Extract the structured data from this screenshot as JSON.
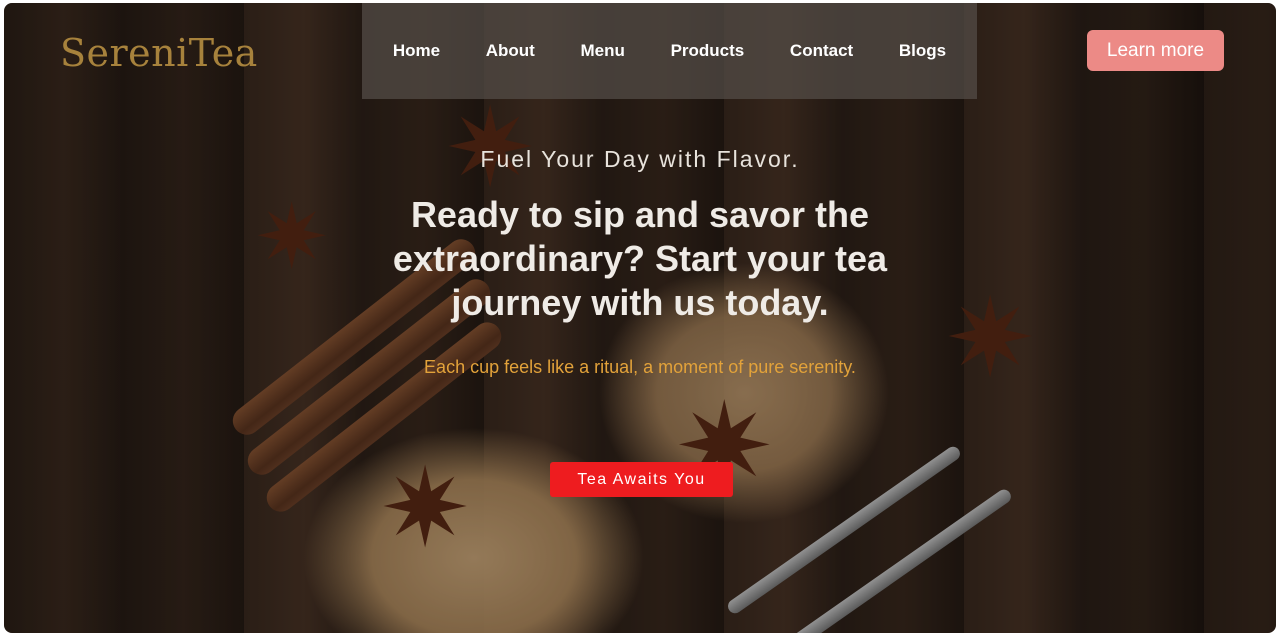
{
  "brand": {
    "name": "SereniTea"
  },
  "nav": {
    "items": [
      {
        "label": "Home"
      },
      {
        "label": "About"
      },
      {
        "label": "Menu"
      },
      {
        "label": "Products"
      },
      {
        "label": "Contact"
      },
      {
        "label": "Blogs"
      }
    ]
  },
  "header": {
    "cta_label": "Learn more"
  },
  "hero": {
    "tagline": "Fuel Your Day with Flavor.",
    "headline": "Ready to sip and savor the extraordinary? Start your tea journey with us today.",
    "subtext": "Each cup feels like a ritual, a moment of pure serenity.",
    "cta_label": "Tea Awaits You"
  },
  "colors": {
    "brand": "#a7823c",
    "learn_more_button": "#ec8a86",
    "cta_button": "#ee1c1f",
    "subtext": "#e2a23a"
  },
  "icons": [
    "star-anise-icon",
    "cinnamon-icon",
    "spoon-icon"
  ]
}
